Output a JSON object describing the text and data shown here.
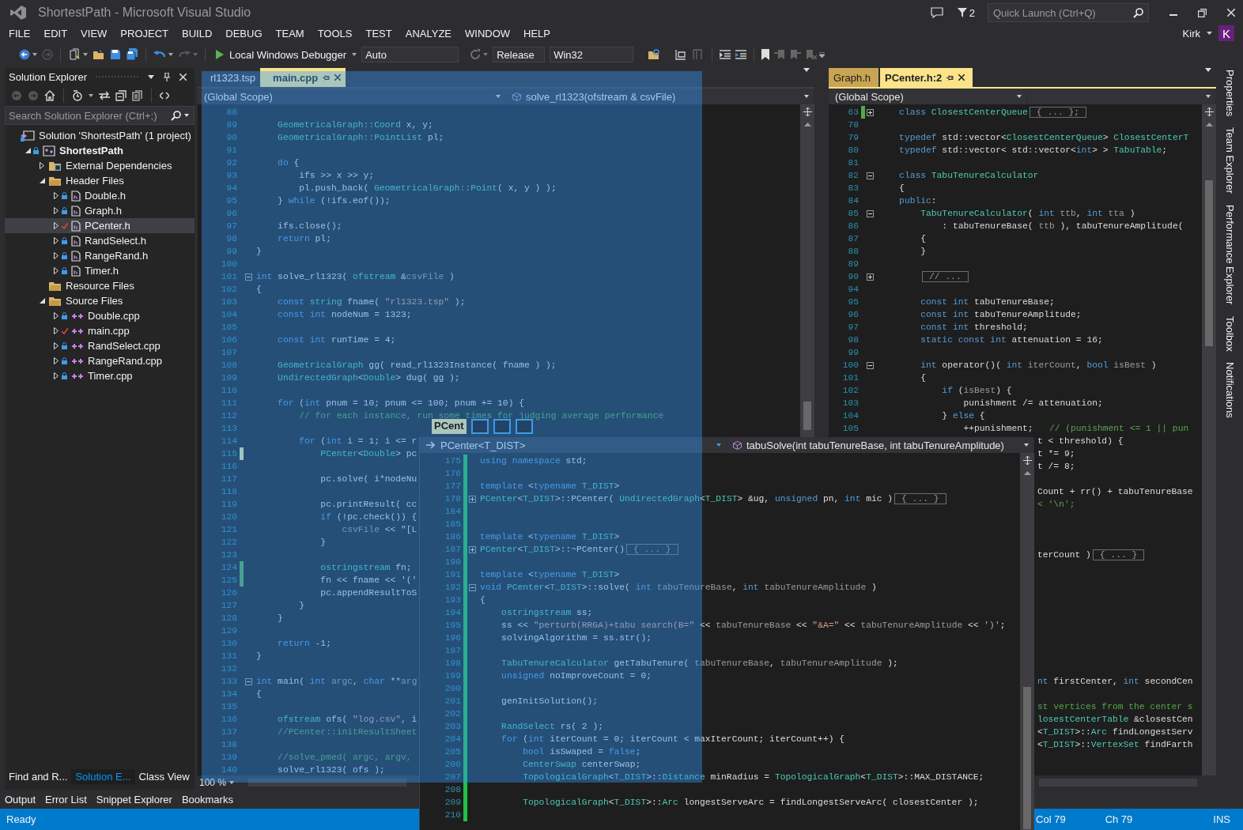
{
  "window": {
    "title": "ShortestPath - Microsoft Visual Studio",
    "notification_count": "2",
    "quick_launch": {
      "placeholder": "Quick Launch (Ctrl+Q)"
    }
  },
  "menu": [
    "FILE",
    "EDIT",
    "VIEW",
    "PROJECT",
    "BUILD",
    "DEBUG",
    "TEAM",
    "TOOLS",
    "TEST",
    "ANALYZE",
    "WINDOW",
    "HELP"
  ],
  "account": {
    "name": "Kirk",
    "initial": "K"
  },
  "toolbar": {
    "debugger": "Local Windows Debugger",
    "debug_target": "Auto",
    "configuration": "Release",
    "platform": "Win32"
  },
  "solution_explorer": {
    "title": "Solution Explorer",
    "search": {
      "placeholder": "Search Solution Explorer (Ctrl+;)"
    },
    "tree": [
      {
        "label": "Solution 'ShortestPath' (1 project)",
        "kind": "solution",
        "selected": false,
        "children": [
          {
            "label": "ShortestPath",
            "kind": "project",
            "checked_out": false,
            "expanded": true,
            "selected": false,
            "children": [
              {
                "label": "External Dependencies",
                "kind": "deps",
                "expanded": false,
                "selected": false
              },
              {
                "label": "Header Files",
                "kind": "folder",
                "expanded": true,
                "selected": false,
                "children": [
                  {
                    "label": "Double.h",
                    "kind": "header",
                    "checked_out": false,
                    "expanded": false,
                    "selected": false
                  },
                  {
                    "label": "Graph.h",
                    "kind": "header",
                    "checked_out": false,
                    "expanded": false,
                    "selected": false
                  },
                  {
                    "label": "PCenter.h",
                    "kind": "header",
                    "checked_out": true,
                    "expanded": false,
                    "selected": true
                  },
                  {
                    "label": "RandSelect.h",
                    "kind": "header",
                    "checked_out": false,
                    "expanded": false,
                    "selected": false
                  },
                  {
                    "label": "RangeRand.h",
                    "kind": "header",
                    "checked_out": false,
                    "expanded": false,
                    "selected": false
                  },
                  {
                    "label": "Timer.h",
                    "kind": "header",
                    "checked_out": false,
                    "expanded": false,
                    "selected": false
                  }
                ]
              },
              {
                "label": "Resource Files",
                "kind": "folder",
                "selected": false
              },
              {
                "label": "Source Files",
                "kind": "folder",
                "expanded": true,
                "selected": false,
                "children": [
                  {
                    "label": "Double.cpp",
                    "kind": "source",
                    "checked_out": false,
                    "expanded": false,
                    "selected": false
                  },
                  {
                    "label": "main.cpp",
                    "kind": "source",
                    "checked_out": true,
                    "expanded": false,
                    "selected": false
                  },
                  {
                    "label": "RandSelect.cpp",
                    "kind": "source",
                    "checked_out": false,
                    "expanded": false,
                    "selected": false
                  },
                  {
                    "label": "RangeRand.cpp",
                    "kind": "source",
                    "checked_out": false,
                    "expanded": false,
                    "selected": false
                  },
                  {
                    "label": "Timer.cpp",
                    "kind": "source",
                    "checked_out": false,
                    "expanded": false,
                    "selected": false
                  }
                ]
              }
            ]
          }
        ]
      }
    ],
    "tabs": [
      {
        "label": "Find and R...",
        "selected": false
      },
      {
        "label": "Solution E...",
        "selected": true
      },
      {
        "label": "Class View",
        "selected": false
      }
    ]
  },
  "left_editor": {
    "tabs": [
      {
        "label": "rl1323.tsp",
        "selected": false
      },
      {
        "label": "main.cpp",
        "selected": true
      }
    ],
    "scope": "(Global Scope)",
    "member": "solve_rl1323(ofstream & csvFile)",
    "zoom": "100 %",
    "lines": [
      {
        "num": "88"
      },
      {
        "num": "89",
        "segs": [
          {
            "kind": "type",
            "text": "    GeometricalGraph::Coord"
          },
          {
            "kind": "plain",
            "text": " x, y;"
          }
        ]
      },
      {
        "num": "90",
        "segs": [
          {
            "kind": "type",
            "text": "    GeometricalGraph::PointList"
          },
          {
            "kind": "plain",
            "text": " pl;"
          }
        ]
      },
      {
        "num": "91"
      },
      {
        "num": "92",
        "segs": [
          {
            "kind": "kw",
            "text": "    do"
          },
          {
            "kind": "plain",
            "text": " {"
          }
        ]
      },
      {
        "num": "93",
        "segs": [
          {
            "kind": "plain",
            "text": "        ifs >> x >> y;"
          }
        ]
      },
      {
        "num": "94",
        "segs": [
          {
            "kind": "plain",
            "text": "        pl.push_back( "
          },
          {
            "kind": "type",
            "text": "GeometricalGraph::Point"
          },
          {
            "kind": "plain",
            "text": "( x, y ) );"
          }
        ]
      },
      {
        "num": "95",
        "segs": [
          {
            "kind": "plain",
            "text": "    } "
          },
          {
            "kind": "kw",
            "text": "while"
          },
          {
            "kind": "plain",
            "text": " (!ifs.eof());"
          }
        ]
      },
      {
        "num": "96"
      },
      {
        "num": "97",
        "segs": [
          {
            "kind": "plain",
            "text": "    ifs.close();"
          }
        ]
      },
      {
        "num": "98",
        "segs": [
          {
            "kind": "kw",
            "text": "    return"
          },
          {
            "kind": "plain",
            "text": " pl;"
          }
        ]
      },
      {
        "num": "99",
        "segs": [
          {
            "kind": "plain",
            "text": "}"
          }
        ]
      },
      {
        "num": "100"
      },
      {
        "num": "101",
        "folded": false,
        "segs": [
          {
            "kind": "kw",
            "text": "int"
          },
          {
            "kind": "plain",
            "text": " solve_rl1323( "
          },
          {
            "kind": "type",
            "text": "ofstream"
          },
          {
            "kind": "plain",
            "text": " &"
          },
          {
            "kind": "param",
            "text": "csvFile"
          },
          {
            "kind": "plain",
            "text": " )"
          }
        ]
      },
      {
        "num": "102",
        "segs": [
          {
            "kind": "plain",
            "text": "{"
          }
        ]
      },
      {
        "num": "103",
        "segs": [
          {
            "kind": "kw",
            "text": "    const "
          },
          {
            "kind": "type",
            "text": "string"
          },
          {
            "kind": "plain",
            "text": " fname( "
          },
          {
            "kind": "str",
            "text": "\"rl1323.tsp\""
          },
          {
            "kind": "plain",
            "text": " );"
          }
        ]
      },
      {
        "num": "104",
        "segs": [
          {
            "kind": "kw",
            "text": "    const int"
          },
          {
            "kind": "plain",
            "text": " nodeNum = 1323;"
          }
        ]
      },
      {
        "num": "105"
      },
      {
        "num": "106",
        "segs": [
          {
            "kind": "kw",
            "text": "    const int"
          },
          {
            "kind": "plain",
            "text": " runTime = 4;"
          }
        ]
      },
      {
        "num": "107"
      },
      {
        "num": "108",
        "segs": [
          {
            "kind": "type",
            "text": "    GeometricalGraph"
          },
          {
            "kind": "plain",
            "text": " gg( read_rl1323Instance( fname ) );"
          }
        ]
      },
      {
        "num": "109",
        "segs": [
          {
            "kind": "type",
            "text": "    UndirectedGraph"
          },
          {
            "kind": "plain",
            "text": "<"
          },
          {
            "kind": "type",
            "text": "Double"
          },
          {
            "kind": "plain",
            "text": "> dug( gg );"
          }
        ]
      },
      {
        "num": "110"
      },
      {
        "num": "111",
        "segs": [
          {
            "kind": "kw",
            "text": "    for"
          },
          {
            "kind": "plain",
            "text": " ("
          },
          {
            "kind": "kw",
            "text": "int"
          },
          {
            "kind": "plain",
            "text": " pnum = 10; pnum <= 100; pnum += 10) {"
          }
        ]
      },
      {
        "num": "112",
        "segs": [
          {
            "kind": "cmt",
            "text": "        // for each instance, run some times for judging average performance"
          }
        ]
      },
      {
        "num": "113"
      },
      {
        "num": "114",
        "segs": [
          {
            "kind": "kw",
            "text": "        for"
          },
          {
            "kind": "plain",
            "text": " ("
          },
          {
            "kind": "kw",
            "text": "int"
          },
          {
            "kind": "plain",
            "text": " i = 1; i <= r"
          }
        ]
      },
      {
        "num": "115",
        "unsaved": true,
        "segs": [
          {
            "kind": "type",
            "text": "            PCenter"
          },
          {
            "kind": "plain",
            "text": "<"
          },
          {
            "kind": "type",
            "text": "Double"
          },
          {
            "kind": "plain",
            "text": "> pc"
          }
        ]
      },
      {
        "num": "116"
      },
      {
        "num": "117",
        "segs": [
          {
            "kind": "plain",
            "text": "            pc.solve( i*nodeNu"
          }
        ]
      },
      {
        "num": "118"
      },
      {
        "num": "119",
        "segs": [
          {
            "kind": "plain",
            "text": "            pc.printResult( cc"
          }
        ]
      },
      {
        "num": "120",
        "segs": [
          {
            "kind": "kw",
            "text": "            if"
          },
          {
            "kind": "plain",
            "text": " (!pc.check()) {"
          }
        ]
      },
      {
        "num": "121",
        "segs": [
          {
            "kind": "param",
            "text": "                csvFile"
          },
          {
            "kind": "plain",
            "text": " << \"[L"
          }
        ]
      },
      {
        "num": "122",
        "segs": [
          {
            "kind": "plain",
            "text": "            }"
          }
        ]
      },
      {
        "num": "123"
      },
      {
        "num": "124",
        "unsaved": false,
        "segs": [
          {
            "kind": "type",
            "text": "            ostringstream"
          },
          {
            "kind": "plain",
            "text": " fn;"
          }
        ]
      },
      {
        "num": "125",
        "unsaved": false,
        "segs": [
          {
            "kind": "plain",
            "text": "            fn << fname << '('"
          }
        ]
      },
      {
        "num": "126",
        "segs": [
          {
            "kind": "plain",
            "text": "            pc.appendResultToS"
          }
        ]
      },
      {
        "num": "127",
        "segs": [
          {
            "kind": "plain",
            "text": "        }"
          }
        ]
      },
      {
        "num": "128",
        "segs": [
          {
            "kind": "plain",
            "text": "    }"
          }
        ]
      },
      {
        "num": "129"
      },
      {
        "num": "130",
        "segs": [
          {
            "kind": "kw",
            "text": "    return"
          },
          {
            "kind": "plain",
            "text": " -1;"
          }
        ]
      },
      {
        "num": "131",
        "segs": [
          {
            "kind": "plain",
            "text": "}"
          }
        ]
      },
      {
        "num": "132"
      },
      {
        "num": "133",
        "folded": false,
        "segs": [
          {
            "kind": "kw",
            "text": "int"
          },
          {
            "kind": "plain",
            "text": " main( "
          },
          {
            "kind": "kw",
            "text": "int "
          },
          {
            "kind": "param",
            "text": "argc"
          },
          {
            "kind": "plain",
            "text": ", "
          },
          {
            "kind": "kw",
            "text": "char"
          },
          {
            "kind": "plain",
            "text": " **"
          },
          {
            "kind": "param",
            "text": "arg"
          }
        ]
      },
      {
        "num": "134",
        "segs": [
          {
            "kind": "plain",
            "text": "{"
          }
        ]
      },
      {
        "num": "135"
      },
      {
        "num": "136",
        "segs": [
          {
            "kind": "type",
            "text": "    ofstream"
          },
          {
            "kind": "plain",
            "text": " ofs( "
          },
          {
            "kind": "str",
            "text": "\"log.csv\""
          },
          {
            "kind": "plain",
            "text": ", i"
          }
        ]
      },
      {
        "num": "137",
        "segs": [
          {
            "kind": "cmt",
            "text": "    //PCenter::initResultSheet"
          }
        ]
      },
      {
        "num": "138"
      },
      {
        "num": "139",
        "segs": [
          {
            "kind": "cmt",
            "text": "    //solve_pmed( argc, argv,"
          }
        ]
      },
      {
        "num": "140",
        "segs": [
          {
            "kind": "plain",
            "text": "    solve_rl1323( ofs );"
          }
        ]
      }
    ]
  },
  "right_editor": {
    "tabs": [
      {
        "label": "Graph.h",
        "selected": false
      },
      {
        "label": "PCenter.h:2",
        "selected": true
      }
    ],
    "scope": "(Global Scope)",
    "lines": [
      {
        "num": "63",
        "unsaved": false,
        "folded": true,
        "segs": [
          {
            "kind": "kw",
            "text": "    class "
          },
          {
            "kind": "type",
            "text": "ClosestCenterQueue"
          },
          {
            "kind": "fold",
            "text": "{ ... };"
          }
        ]
      },
      {
        "num": "78"
      },
      {
        "num": "79",
        "segs": [
          {
            "kind": "kw",
            "text": "    typedef"
          },
          {
            "kind": "plain",
            "text": " std::vector<"
          },
          {
            "kind": "type",
            "text": "ClosestCenterQueue"
          },
          {
            "kind": "plain",
            "text": "> "
          },
          {
            "kind": "type",
            "text": "ClosestCenterT"
          }
        ]
      },
      {
        "num": "80",
        "segs": [
          {
            "kind": "kw",
            "text": "    typedef"
          },
          {
            "kind": "plain",
            "text": " std::vector< std::vector<"
          },
          {
            "kind": "kw",
            "text": "int"
          },
          {
            "kind": "plain",
            "text": "> > "
          },
          {
            "kind": "type",
            "text": "TabuTable"
          },
          {
            "kind": "plain",
            "text": ";"
          }
        ]
      },
      {
        "num": "81"
      },
      {
        "num": "82",
        "folded": false,
        "segs": [
          {
            "kind": "kw",
            "text": "    class "
          },
          {
            "kind": "type",
            "text": "TabuTenureCalculator"
          }
        ]
      },
      {
        "num": "83",
        "segs": [
          {
            "kind": "plain",
            "text": "    {"
          }
        ]
      },
      {
        "num": "84",
        "segs": [
          {
            "kind": "kw",
            "text": "    public"
          },
          {
            "kind": "plain",
            "text": ":"
          }
        ]
      },
      {
        "num": "85",
        "folded": false,
        "segs": [
          {
            "kind": "type",
            "text": "        TabuTenureCalculator"
          },
          {
            "kind": "plain",
            "text": "( "
          },
          {
            "kind": "kw",
            "text": "int "
          },
          {
            "kind": "param",
            "text": "ttb"
          },
          {
            "kind": "plain",
            "text": ", "
          },
          {
            "kind": "kw",
            "text": "int "
          },
          {
            "kind": "param",
            "text": "tta"
          },
          {
            "kind": "plain",
            "text": " )"
          }
        ]
      },
      {
        "num": "86",
        "segs": [
          {
            "kind": "plain",
            "text": "            : tabuTenureBase( "
          },
          {
            "kind": "param",
            "text": "ttb"
          },
          {
            "kind": "plain",
            "text": " ), tabuTenureAmplitude("
          }
        ]
      },
      {
        "num": "87",
        "segs": [
          {
            "kind": "plain",
            "text": "        {"
          }
        ]
      },
      {
        "num": "88",
        "segs": [
          {
            "kind": "plain",
            "text": "        }"
          }
        ]
      },
      {
        "num": "89"
      },
      {
        "num": "90",
        "folded": true,
        "segs": [
          {
            "kind": "fold",
            "text": "// ..."
          }
        ]
      },
      {
        "num": "94"
      },
      {
        "num": "95",
        "segs": [
          {
            "kind": "kw",
            "text": "        const int"
          },
          {
            "kind": "plain",
            "text": " tabuTenureBase;"
          }
        ]
      },
      {
        "num": "96",
        "segs": [
          {
            "kind": "kw",
            "text": "        const int"
          },
          {
            "kind": "plain",
            "text": " tabuTenureAmplitude;"
          }
        ]
      },
      {
        "num": "97",
        "segs": [
          {
            "kind": "kw",
            "text": "        const int"
          },
          {
            "kind": "plain",
            "text": " threshold;"
          }
        ]
      },
      {
        "num": "98",
        "segs": [
          {
            "kind": "kw",
            "text": "        static const int"
          },
          {
            "kind": "plain",
            "text": " attenuation = 16;"
          }
        ]
      },
      {
        "num": "99"
      },
      {
        "num": "100",
        "folded": false,
        "segs": [
          {
            "kind": "kw",
            "text": "        int"
          },
          {
            "kind": "plain",
            "text": " operator()( "
          },
          {
            "kind": "kw",
            "text": "int "
          },
          {
            "kind": "param",
            "text": "iterCount"
          },
          {
            "kind": "plain",
            "text": ", "
          },
          {
            "kind": "kw",
            "text": "bool "
          },
          {
            "kind": "param",
            "text": "isBest"
          },
          {
            "kind": "plain",
            "text": " )"
          }
        ]
      },
      {
        "num": "101",
        "segs": [
          {
            "kind": "plain",
            "text": "        {"
          }
        ]
      },
      {
        "num": "102",
        "segs": [
          {
            "kind": "kw",
            "text": "            if"
          },
          {
            "kind": "plain",
            "text": " ("
          },
          {
            "kind": "param",
            "text": "isBest"
          },
          {
            "kind": "plain",
            "text": ") {"
          }
        ]
      },
      {
        "num": "103",
        "segs": [
          {
            "kind": "plain",
            "text": "                punishment /= attenuation;"
          }
        ]
      },
      {
        "num": "104",
        "segs": [
          {
            "kind": "plain",
            "text": "            } "
          },
          {
            "kind": "kw",
            "text": "else"
          },
          {
            "kind": "plain",
            "text": " {"
          }
        ]
      },
      {
        "num": "105",
        "segs": [
          {
            "kind": "plain",
            "text": "                ++punishment;   "
          },
          {
            "kind": "cmt",
            "text": "// (punishment <= 1 || pun"
          }
        ]
      }
    ],
    "covered_blocks": [
      {
        "lines": [
          {
            "segs": [
              {
                "kind": "plain",
                "text": "t < threshold) {"
              }
            ]
          },
          {
            "segs": [
              {
                "kind": "plain",
                "text": "t *= 9;"
              }
            ]
          },
          {
            "segs": [
              {
                "kind": "plain",
                "text": "t /= 8;"
              }
            ]
          }
        ]
      },
      {
        "lines": [
          {
            "segs": [
              {
                "kind": "plain",
                "text": "Count + rr() + tabuTenureBase"
              }
            ]
          },
          {
            "segs": [
              {
                "kind": "cmt",
                "text": "< '\\n';"
              }
            ]
          }
        ]
      },
      {
        "lines": [
          {
            "segs": [
              {
                "kind": "plain",
                "text": "terCount )"
              },
              {
                "kind": "fold",
                "text": "{ ... }"
              }
            ]
          }
        ]
      },
      {
        "lines": [
          {
            "segs": [
              {
                "kind": "kw",
                "text": "nt"
              },
              {
                "kind": "plain",
                "text": " firstCenter, "
              },
              {
                "kind": "kw",
                "text": "int"
              },
              {
                "kind": "plain",
                "text": " secondCen"
              }
            ]
          }
        ]
      },
      {
        "lines": [
          {
            "segs": [
              {
                "kind": "cmt",
                "text": "st vertices from the center s"
              }
            ]
          },
          {
            "segs": [
              {
                "kind": "type",
                "text": "losestCenterTable"
              },
              {
                "kind": "plain",
                "text": " &closestCen"
              }
            ]
          },
          {
            "segs": [
              {
                "kind": "plain",
                "text": "<"
              },
              {
                "kind": "type",
                "text": "T_DIST"
              },
              {
                "kind": "plain",
                "text": ">::"
              },
              {
                "kind": "type",
                "text": "Arc"
              },
              {
                "kind": "plain",
                "text": " findLongestServ"
              }
            ]
          },
          {
            "segs": [
              {
                "kind": "plain",
                "text": "<"
              },
              {
                "kind": "type",
                "text": "T_DIST"
              },
              {
                "kind": "plain",
                "text": ">::"
              },
              {
                "kind": "type",
                "text": "VertexSet"
              },
              {
                "kind": "plain",
                "text": " findFarth"
              }
            ]
          }
        ]
      }
    ]
  },
  "floating_window": {
    "tab_preview": "PCent",
    "type_scope": "PCenter<T_DIST>",
    "member": "tabuSolve(int tabuTenureBase, int tabuTenureAmplitude)",
    "lines": [
      {
        "num": "175",
        "unsaved": false,
        "segs": [
          {
            "kind": "kw",
            "text": "using namespace"
          },
          {
            "kind": "plain",
            "text": " std;"
          }
        ]
      },
      {
        "num": "176",
        "unsaved": false
      },
      {
        "num": "177",
        "unsaved": false,
        "segs": [
          {
            "kind": "kw",
            "text": "template"
          },
          {
            "kind": "plain",
            "text": " <"
          },
          {
            "kind": "kw",
            "text": "typename "
          },
          {
            "kind": "type",
            "text": "T_DIST"
          },
          {
            "kind": "plain",
            "text": ">"
          }
        ]
      },
      {
        "num": "178",
        "unsaved": false,
        "folded": true,
        "segs": [
          {
            "kind": "type",
            "text": "PCenter"
          },
          {
            "kind": "plain",
            "text": "<"
          },
          {
            "kind": "type",
            "text": "T_DIST"
          },
          {
            "kind": "plain",
            "text": ">::PCenter( "
          },
          {
            "kind": "type",
            "text": "UndirectedGraph"
          },
          {
            "kind": "plain",
            "text": "<"
          },
          {
            "kind": "type",
            "text": "T_DIST"
          },
          {
            "kind": "plain",
            "text": "> &ug, "
          },
          {
            "kind": "kw",
            "text": "unsigned"
          },
          {
            "kind": "plain",
            "text": " pn, "
          },
          {
            "kind": "kw",
            "text": "int"
          },
          {
            "kind": "plain",
            "text": " mic )"
          },
          {
            "kind": "fold",
            "text": "{ ... }"
          }
        ]
      },
      {
        "num": "184",
        "unsaved": false
      },
      {
        "num": "185",
        "unsaved": false
      },
      {
        "num": "186",
        "unsaved": false,
        "segs": [
          {
            "kind": "kw",
            "text": "template"
          },
          {
            "kind": "plain",
            "text": " <"
          },
          {
            "kind": "kw",
            "text": "typename "
          },
          {
            "kind": "type",
            "text": "T_DIST"
          },
          {
            "kind": "plain",
            "text": ">"
          }
        ]
      },
      {
        "num": "187",
        "unsaved": false,
        "folded": true,
        "segs": [
          {
            "kind": "type",
            "text": "PCenter"
          },
          {
            "kind": "plain",
            "text": "<"
          },
          {
            "kind": "type",
            "text": "T_DIST"
          },
          {
            "kind": "plain",
            "text": ">::~PCenter()"
          },
          {
            "kind": "fold",
            "text": "{ ... }"
          }
        ]
      },
      {
        "num": "190",
        "unsaved": false
      },
      {
        "num": "191",
        "unsaved": false,
        "segs": [
          {
            "kind": "kw",
            "text": "template"
          },
          {
            "kind": "plain",
            "text": " <"
          },
          {
            "kind": "kw",
            "text": "typename "
          },
          {
            "kind": "type",
            "text": "T_DIST"
          },
          {
            "kind": "plain",
            "text": ">"
          }
        ]
      },
      {
        "num": "192",
        "unsaved": false,
        "folded": false,
        "segs": [
          {
            "kind": "kw",
            "text": "void "
          },
          {
            "kind": "type",
            "text": "PCenter"
          },
          {
            "kind": "plain",
            "text": "<"
          },
          {
            "kind": "type",
            "text": "T_DIST"
          },
          {
            "kind": "plain",
            "text": ">::solve( "
          },
          {
            "kind": "kw",
            "text": "int "
          },
          {
            "kind": "param",
            "text": "tabuTenureBase"
          },
          {
            "kind": "plain",
            "text": ", "
          },
          {
            "kind": "kw",
            "text": "int "
          },
          {
            "kind": "param",
            "text": "tabuTenureAmplitude"
          },
          {
            "kind": "plain",
            "text": " )"
          }
        ]
      },
      {
        "num": "193",
        "unsaved": false,
        "segs": [
          {
            "kind": "plain",
            "text": "{"
          }
        ]
      },
      {
        "num": "194",
        "unsaved": false,
        "segs": [
          {
            "kind": "type",
            "text": "    ostringstream"
          },
          {
            "kind": "plain",
            "text": " ss;"
          }
        ]
      },
      {
        "num": "195",
        "unsaved": false,
        "segs": [
          {
            "kind": "plain",
            "text": "    ss << "
          },
          {
            "kind": "str",
            "text": "\"perturb(RRGA)+tabu search(B=\""
          },
          {
            "kind": "plain",
            "text": " << "
          },
          {
            "kind": "param",
            "text": "tabuTenureBase"
          },
          {
            "kind": "plain",
            "text": " << "
          },
          {
            "kind": "str",
            "text": "\"&A=\""
          },
          {
            "kind": "plain",
            "text": " << "
          },
          {
            "kind": "param",
            "text": "tabuTenureAmplitude"
          },
          {
            "kind": "plain",
            "text": " << "
          },
          {
            "kind": "str",
            "text": "')'"
          },
          {
            "kind": "plain",
            "text": ";"
          }
        ]
      },
      {
        "num": "196",
        "unsaved": false,
        "segs": [
          {
            "kind": "plain",
            "text": "    solvingAlgorithm = ss.str();"
          }
        ]
      },
      {
        "num": "197",
        "unsaved": false
      },
      {
        "num": "198",
        "unsaved": false,
        "segs": [
          {
            "kind": "type",
            "text": "    TabuTenureCalculator"
          },
          {
            "kind": "plain",
            "text": " getTabuTenure( "
          },
          {
            "kind": "param",
            "text": "tabuTenureBase"
          },
          {
            "kind": "plain",
            "text": ", "
          },
          {
            "kind": "param",
            "text": "tabuTenureAmplitude"
          },
          {
            "kind": "plain",
            "text": " );"
          }
        ]
      },
      {
        "num": "199",
        "unsaved": false,
        "segs": [
          {
            "kind": "kw",
            "text": "    unsigned"
          },
          {
            "kind": "plain",
            "text": " noImproveCount = 0;"
          }
        ]
      },
      {
        "num": "200",
        "unsaved": false
      },
      {
        "num": "201",
        "unsaved": false,
        "segs": [
          {
            "kind": "plain",
            "text": "    genInitSolution();"
          }
        ]
      },
      {
        "num": "202",
        "unsaved": false
      },
      {
        "num": "203",
        "unsaved": false,
        "segs": [
          {
            "kind": "type",
            "text": "    RandSelect"
          },
          {
            "kind": "plain",
            "text": " rs( 2 );"
          }
        ]
      },
      {
        "num": "204",
        "unsaved": false,
        "segs": [
          {
            "kind": "kw",
            "text": "    for"
          },
          {
            "kind": "plain",
            "text": " ("
          },
          {
            "kind": "kw",
            "text": "int"
          },
          {
            "kind": "plain",
            "text": " iterCount = 0; iterCount < maxIterCount; iterCount++) {"
          }
        ]
      },
      {
        "num": "205",
        "unsaved": false,
        "segs": [
          {
            "kind": "kw",
            "text": "        bool"
          },
          {
            "kind": "plain",
            "text": " isSwaped = "
          },
          {
            "kind": "kw",
            "text": "false"
          },
          {
            "kind": "plain",
            "text": ";"
          }
        ]
      },
      {
        "num": "206",
        "unsaved": false,
        "segs": [
          {
            "kind": "type",
            "text": "        CenterSwap"
          },
          {
            "kind": "plain",
            "text": " centerSwap;"
          }
        ]
      },
      {
        "num": "207",
        "unsaved": false,
        "segs": [
          {
            "kind": "type",
            "text": "        TopologicalGraph"
          },
          {
            "kind": "plain",
            "text": "<"
          },
          {
            "kind": "type",
            "text": "T_DIST"
          },
          {
            "kind": "plain",
            "text": ">::"
          },
          {
            "kind": "type",
            "text": "Distance"
          },
          {
            "kind": "plain",
            "text": " minRadius = "
          },
          {
            "kind": "type",
            "text": "TopologicalGraph"
          },
          {
            "kind": "plain",
            "text": "<"
          },
          {
            "kind": "type",
            "text": "T_DIST"
          },
          {
            "kind": "plain",
            "text": ">::MAX_DISTANCE;"
          }
        ]
      },
      {
        "num": "208",
        "unsaved": false
      },
      {
        "num": "209",
        "unsaved": false,
        "segs": [
          {
            "kind": "type",
            "text": "        TopologicalGraph"
          },
          {
            "kind": "plain",
            "text": "<"
          },
          {
            "kind": "type",
            "text": "T_DIST"
          },
          {
            "kind": "plain",
            "text": ">::"
          },
          {
            "kind": "type",
            "text": "Arc"
          },
          {
            "kind": "plain",
            "text": " longestServeArc = findLongestServeArc( closestCenter );"
          }
        ]
      },
      {
        "num": "210",
        "unsaved": false
      }
    ]
  },
  "side_tabs": [
    "Properties",
    "Team Explorer",
    "Performance Explorer",
    "Toolbox",
    "Notifications"
  ],
  "tool_tabs": [
    "Output",
    "Error List",
    "Snippet Explorer",
    "Bookmarks"
  ],
  "status_bar": {
    "message": "Ready",
    "column": "Col 79",
    "char": "Ch 79",
    "mode": "INS"
  }
}
